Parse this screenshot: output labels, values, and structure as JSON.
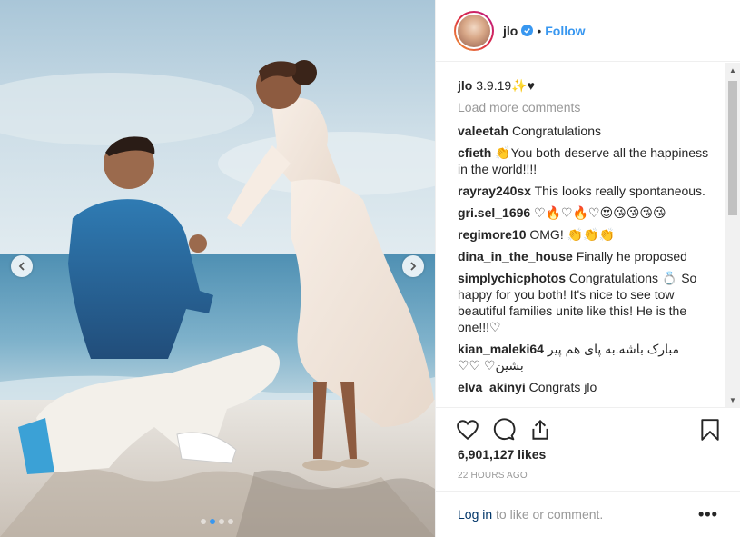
{
  "post": {
    "username": "jlo",
    "follow_label": "Follow",
    "separator": "•",
    "caption": {
      "username": "jlo",
      "text": "3.9.19✨♥"
    },
    "load_more_label": "Load more comments",
    "comments": [
      {
        "username": "valeetah",
        "text": "Congratulations"
      },
      {
        "username": "cfieth",
        "text": "👏You both deserve all the happiness in the world!!!!"
      },
      {
        "username": "rayray240sx",
        "text": "This looks really spontaneous."
      },
      {
        "username": "gri.sel_1696",
        "text": "♡🔥♡🔥♡😍😘😘😘😘"
      },
      {
        "username": "regimore10",
        "text": "OMG! 👏👏👏"
      },
      {
        "username": "dina_in_the_house",
        "text": "Finally he proposed"
      },
      {
        "username": "simplychicphotos",
        "text": "Congratulations 💍 So happy for you both! It's nice to see tow beautiful families unite like this! He is the one!!!♡"
      },
      {
        "username": "kian_maleki64",
        "text": "مبارک باشه.به پای هم پیر بشین♡ ♡♡"
      },
      {
        "username": "elva_akinyi",
        "text": "Congrats jlo"
      }
    ],
    "likes": "6,901,127 likes",
    "timestamp": "22 HOURS AGO",
    "login_link": "Log in",
    "login_rest": " to like or comment.",
    "more_label": "•••",
    "icons": {
      "verified": "verified-badge-icon",
      "heart": "heart-icon",
      "comment": "comment-icon",
      "share": "share-icon",
      "bookmark": "bookmark-icon"
    },
    "colors": {
      "accent": "#3897f0",
      "muted": "#999999",
      "text": "#262626"
    },
    "carousel": {
      "current": 2,
      "total": 4
    }
  }
}
